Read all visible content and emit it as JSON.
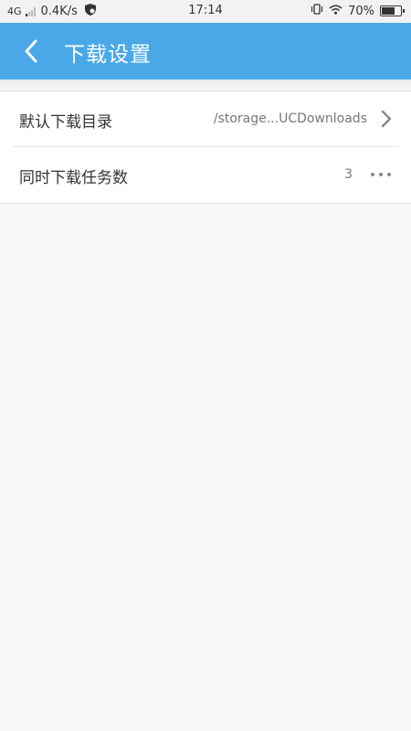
{
  "status_bar": {
    "network": "4G",
    "speed": "0.4K/s",
    "time": "17:14",
    "battery": "70%",
    "battery_level": 0.7,
    "icons": [
      "signal-icon",
      "shield-icon",
      "vibrate-icon",
      "wifi-icon",
      "battery-icon"
    ]
  },
  "app_bar": {
    "title": "下载设置",
    "back_icon": "back-arrow-icon",
    "background_color": "#4aa8e8"
  },
  "settings": {
    "download_dir": {
      "label": "默认下载目录",
      "value": "/storage...UCDownloads",
      "icon": "chevron-right-icon"
    },
    "concurrent_tasks": {
      "label": "同时下载任务数",
      "value": "3",
      "icon": "more-dots-icon"
    }
  }
}
